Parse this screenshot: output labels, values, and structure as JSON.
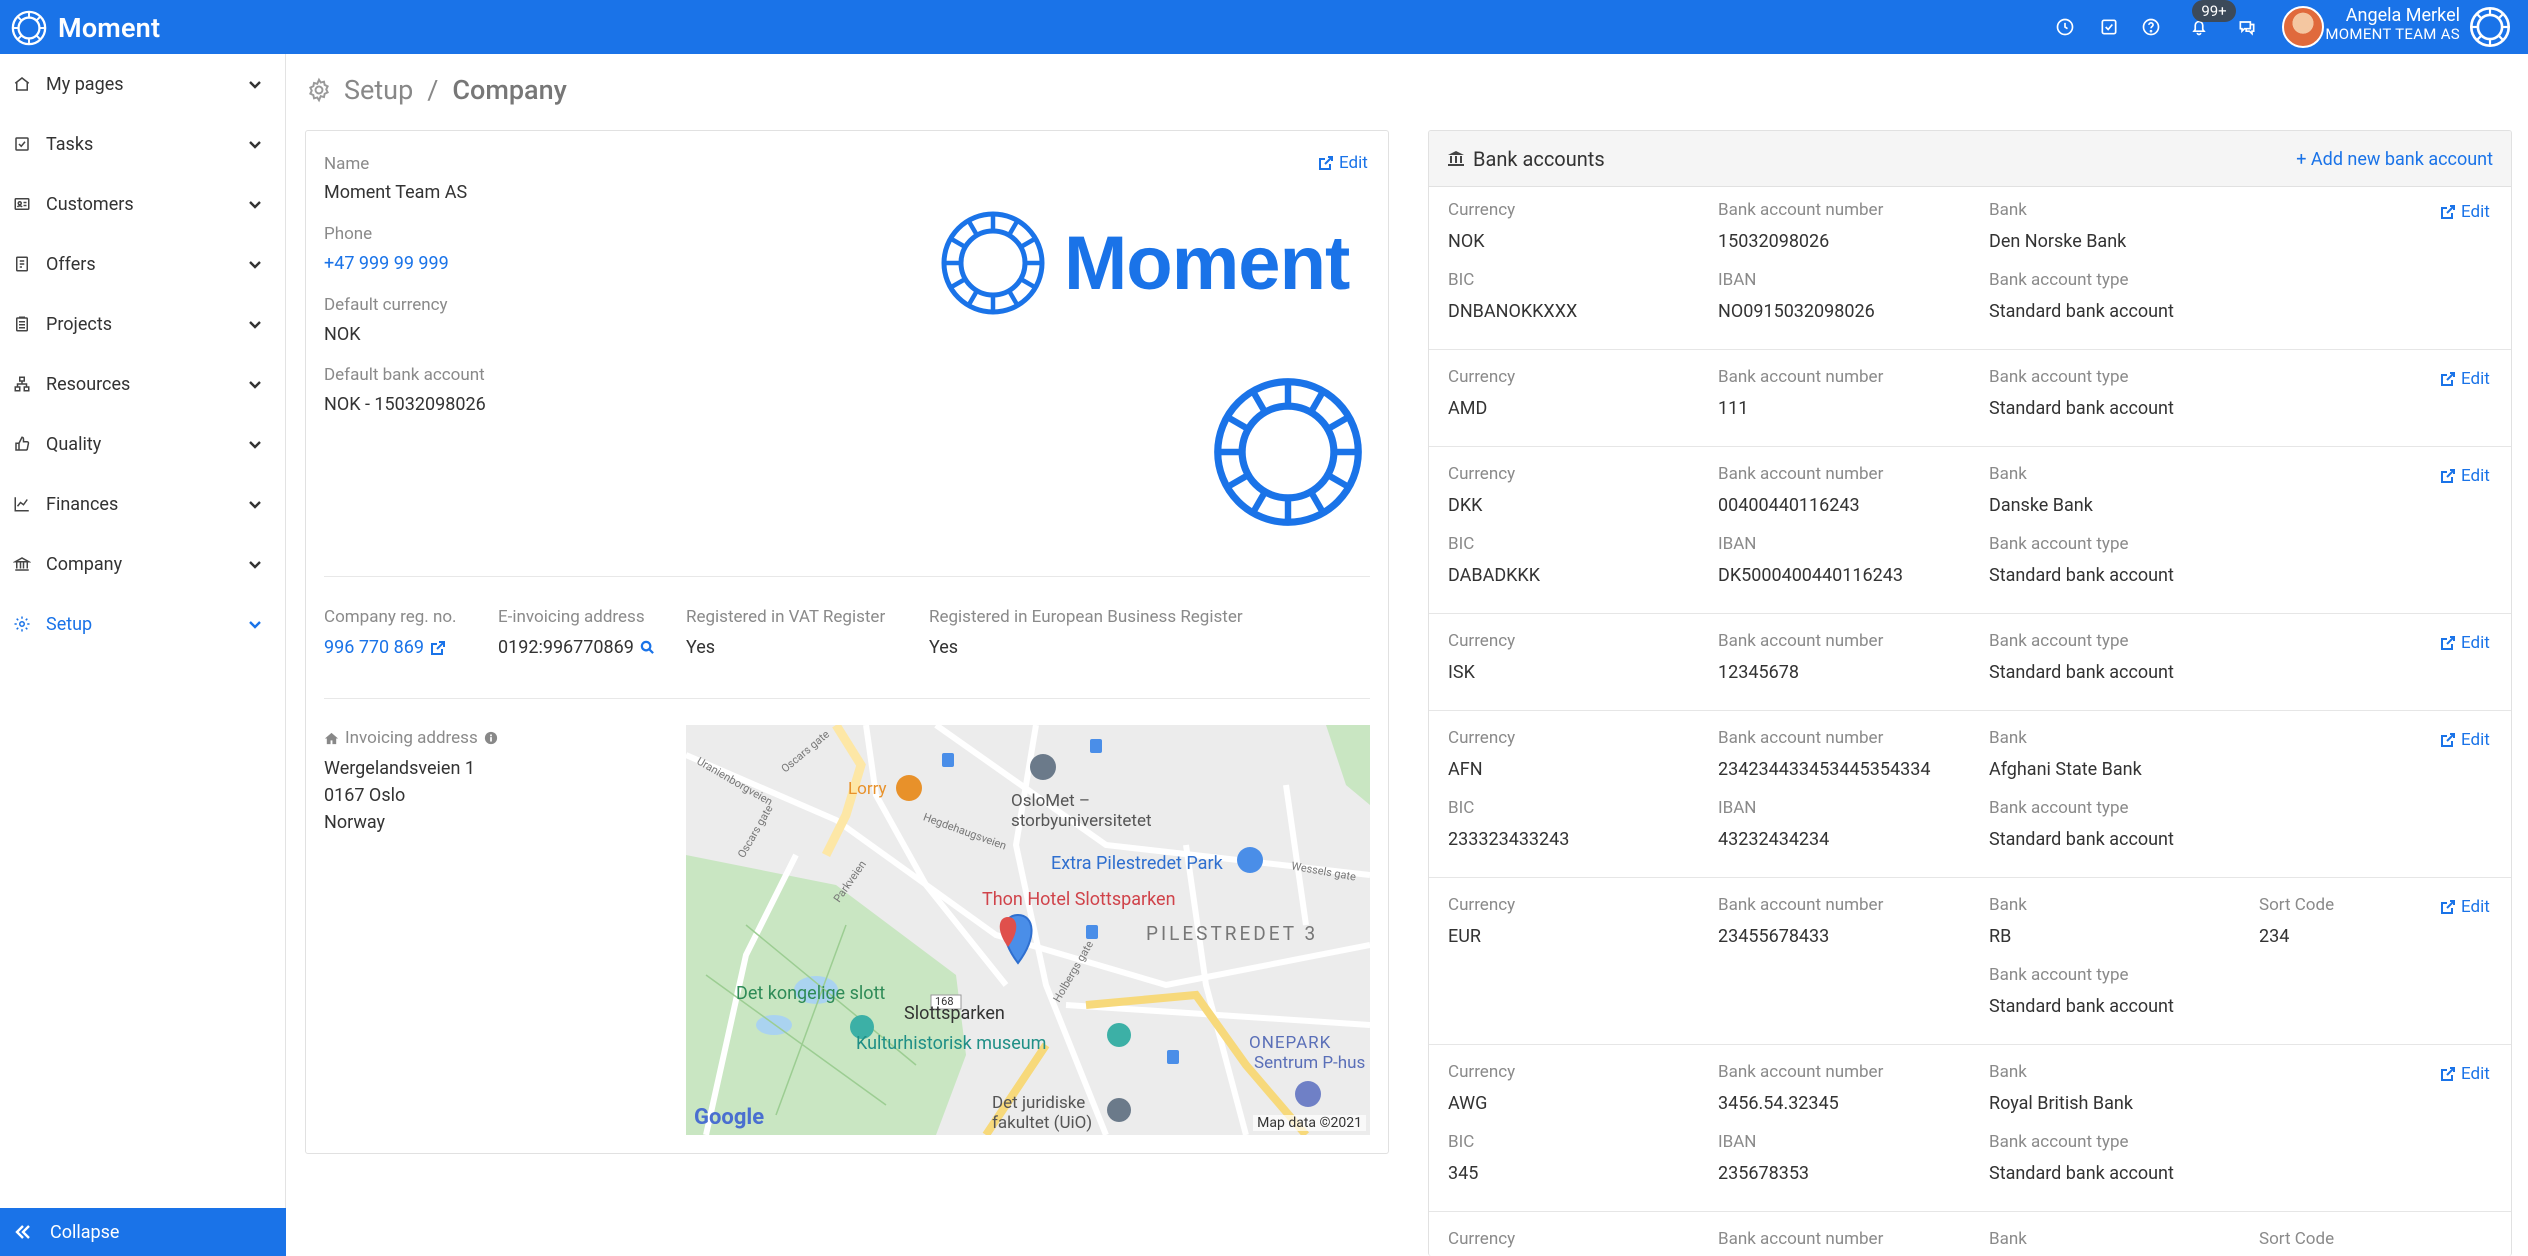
{
  "app": {
    "name": "Moment"
  },
  "topbar": {
    "notification_badge": "99+",
    "user_name": "Angela Merkel",
    "user_company": "MOMENT TEAM AS"
  },
  "sidebar": {
    "items": [
      {
        "label": "My pages",
        "icon": "home-icon"
      },
      {
        "label": "Tasks",
        "icon": "checkbox-icon"
      },
      {
        "label": "Customers",
        "icon": "id-card-icon"
      },
      {
        "label": "Offers",
        "icon": "offers-icon"
      },
      {
        "label": "Projects",
        "icon": "clipboard-icon"
      },
      {
        "label": "Resources",
        "icon": "sitemap-icon"
      },
      {
        "label": "Quality",
        "icon": "thumbs-up-icon"
      },
      {
        "label": "Finances",
        "icon": "chart-line-icon"
      },
      {
        "label": "Company",
        "icon": "bank-icon"
      },
      {
        "label": "Setup",
        "icon": "gear-icon"
      }
    ],
    "collapse_label": "Collapse"
  },
  "breadcrumb": {
    "parent": "Setup",
    "separator": "/",
    "current": "Company"
  },
  "company": {
    "edit_label": "Edit",
    "name_label": "Name",
    "name": "Moment Team AS",
    "phone_label": "Phone",
    "phone": "+47 999 99 999",
    "currency_label": "Default currency",
    "currency": "NOK",
    "bank_label": "Default bank account",
    "bank": "NOK - 15032098026",
    "logo_text": "Moment",
    "reg_label": "Company reg. no.",
    "reg": "996 770 869",
    "einv_label": "E-invoicing address",
    "einv": "0192:996770869",
    "vat_label": "Registered in VAT Register",
    "vat": "Yes",
    "eu_label": "Registered in European Business Register",
    "eu": "Yes",
    "address_label": "Invoicing address",
    "address_line1": "Wergelandsveien 1",
    "address_line2": "0167 Oslo",
    "address_line3": "Norway"
  },
  "map": {
    "labels": {
      "lorry": "Lorry",
      "oslomet1": "OsloMet –",
      "oslomet2": "storbyuniversitetet",
      "extra": "Extra Pilestredet Park",
      "thon": "Thon Hotel Slottsparken",
      "pilestredet": "PILESTREDET 3",
      "kongelige": "Det kongelige slott",
      "slottsparken": "Slottsparken",
      "kultur": "Kulturhistorisk museum",
      "onepark1": "ONEPARK",
      "onepark2": "Sentrum P-hus",
      "juridiske1": "Det juridiske",
      "juridiske2": "fakultet (UiO)",
      "road168": "168",
      "google": "Google",
      "mapdata": "Map data ©2021",
      "street_uranien": "Uranienborgveien",
      "street_oscars": "Oscars gate",
      "street_oscars2": "Oscars gate",
      "street_parkveien": "Parkveien",
      "street_hegdehaug": "Hegdehaugsveien",
      "street_wessels": "Wessels gate",
      "street_holberg": "Holbergs gate"
    }
  },
  "bank": {
    "title": "Bank accounts",
    "add_label": "Add new bank account",
    "edit_label": "Edit",
    "labels": {
      "currency": "Currency",
      "number": "Bank account number",
      "bank": "Bank",
      "bic": "BIC",
      "iban": "IBAN",
      "type": "Bank account type",
      "sort": "Sort Code"
    },
    "accounts": [
      {
        "currency": "NOK",
        "number": "15032098026",
        "bank": "Den Norske Bank",
        "bic": "DNBANOKKXXX",
        "iban": "NO0915032098026",
        "type": "Standard bank account"
      },
      {
        "currency": "AMD",
        "number": "111",
        "type": "Standard bank account"
      },
      {
        "currency": "DKK",
        "number": "00400440116243",
        "bank": "Danske Bank",
        "bic": "DABADKKK",
        "iban": "DK5000400440116243",
        "type": "Standard bank account"
      },
      {
        "currency": "ISK",
        "number": "12345678",
        "type": "Standard bank account"
      },
      {
        "currency": "AFN",
        "number": "234234433453445354334",
        "bank": "Afghani State Bank",
        "bic": "233323433243",
        "iban": "43232434234",
        "type": "Standard bank account"
      },
      {
        "currency": "EUR",
        "number": "23455678433",
        "bank": "RB",
        "sort": "234",
        "type": "Standard bank account"
      },
      {
        "currency": "AWG",
        "number": "3456.54.32345",
        "bank": "Royal British Bank",
        "bic": "345",
        "iban": "235678353",
        "type": "Standard bank account"
      }
    ]
  }
}
